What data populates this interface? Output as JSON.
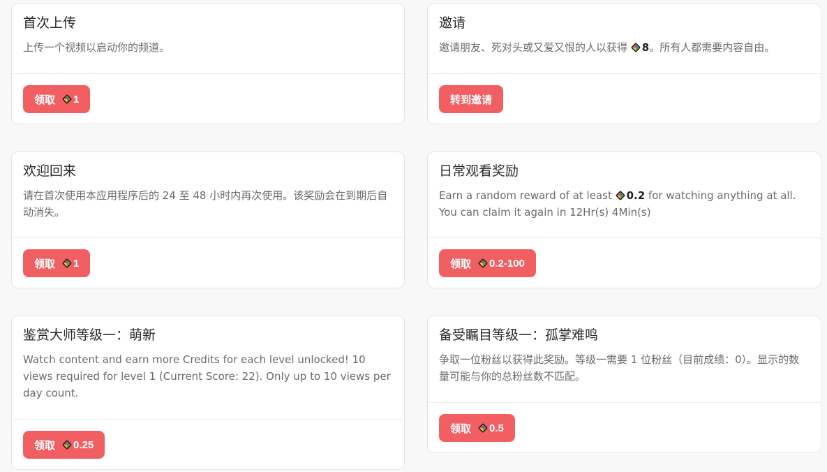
{
  "cards": [
    {
      "title": "首次上传",
      "desc": "上传一个视频以启动你的频道。",
      "button": {
        "label": "领取",
        "amount": "1"
      }
    },
    {
      "title": "邀请",
      "desc_before": "邀请朋友、死对头或又爱又恨的人以获得",
      "desc_value": "8",
      "desc_after": "。所有人都需要内容自由。",
      "button": {
        "label": "转到邀请"
      }
    },
    {
      "title": "欢迎回来",
      "desc": "请在首次使用本应用程序后的 24 至 48 小时内再次使用。该奖励会在到期后自动消失。",
      "button": {
        "label": "领取",
        "amount": "1"
      }
    },
    {
      "title": "日常观看奖励",
      "desc_before": "Earn a random reward of at least",
      "desc_value": "0.2",
      "desc_after": "for watching anything at all.",
      "desc_line2": "You can claim it again in 12Hr(s) 4Min(s)",
      "button": {
        "label": "领取",
        "amount": "0.2-100"
      }
    },
    {
      "title": "鉴赏大师等级一：萌新",
      "desc": "Watch content and earn more Credits for each level unlocked! 10 views required for level 1 (Current Score: 22). Only up to 10 views per day count.",
      "button": {
        "label": "领取",
        "amount": "0.25"
      }
    },
    {
      "title": "备受瞩目等级一：孤掌难鸣",
      "desc": "争取一位粉丝以获得此奖励。等级一需要 1 位粉丝（目前成绩：0）。显示的数量可能与你的总粉丝数不匹配。",
      "button": {
        "label": "领取",
        "amount": "0.5"
      }
    }
  ],
  "colors": {
    "button_bg": "#f25f63",
    "gem_colors": [
      "#e53935",
      "#fbc02d",
      "#43a047",
      "#1e88e5"
    ]
  },
  "icons": {
    "credit": "credit-gem-icon"
  }
}
